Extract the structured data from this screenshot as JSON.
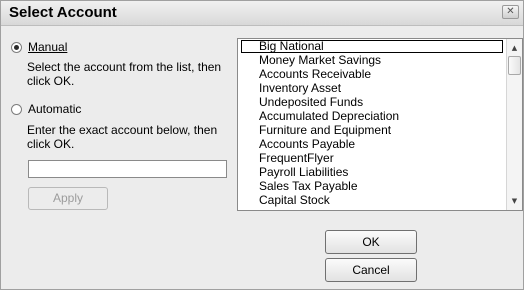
{
  "window": {
    "title": "Select Account",
    "close_glyph": "✕"
  },
  "manual": {
    "label": "Manual",
    "checked": true,
    "help": "Select the account from the list, then click OK."
  },
  "automatic": {
    "label": "Automatic",
    "checked": false,
    "help": "Enter the exact account below, then click OK."
  },
  "account_input": {
    "value": ""
  },
  "buttons": {
    "apply": "Apply",
    "ok": "OK",
    "cancel": "Cancel"
  },
  "accounts": [
    "Big National",
    "Money Market Savings",
    "Accounts Receivable",
    "Inventory Asset",
    "Undeposited Funds",
    "Accumulated Depreciation",
    "Furniture and Equipment",
    "Accounts Payable",
    "FrequentFlyer",
    "Payroll Liabilities",
    "Sales Tax Payable",
    "Capital Stock"
  ],
  "selected_account": "Big National",
  "scrollbar": {
    "up_glyph": "▲",
    "down_glyph": "▼"
  }
}
